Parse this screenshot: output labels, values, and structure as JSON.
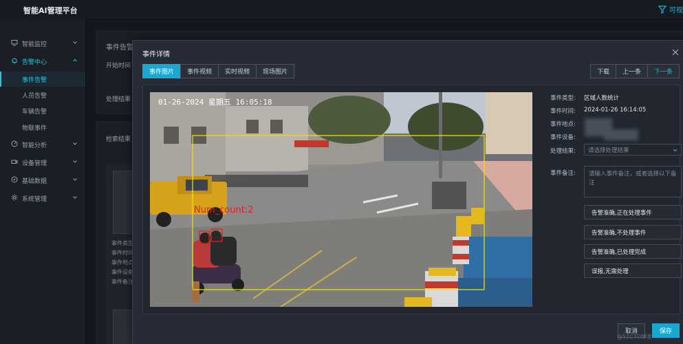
{
  "app": {
    "title": "智能AI管理平台",
    "filter_label": "可视"
  },
  "sidebar": {
    "items": [
      {
        "label": "智能监控",
        "icon": "monitor-icon"
      },
      {
        "label": "告警中心",
        "icon": "bell-icon"
      },
      {
        "label": "智能分析",
        "icon": "analysis-icon"
      },
      {
        "label": "设备管理",
        "icon": "camera-icon"
      },
      {
        "label": "基础数据",
        "icon": "compass-icon"
      },
      {
        "label": "系统管理",
        "icon": "gear-icon"
      }
    ],
    "sub_items": [
      {
        "label": "事件告警"
      },
      {
        "label": "人员告警"
      },
      {
        "label": "车辆告警"
      },
      {
        "label": "物联事件"
      }
    ]
  },
  "background": {
    "card_title": "事件告警",
    "start_time_label": "开始时间",
    "result_label": "处理结果",
    "search_results_label": "检索结果",
    "card_labels": [
      "事件类型",
      "事件时间",
      "事件地点",
      "事件设备",
      "事件备注"
    ]
  },
  "modal": {
    "title": "事件详情",
    "tabs": [
      "事件图片",
      "事件视频",
      "实时视频",
      "现场图片"
    ],
    "nav": [
      "下载",
      "上一条",
      "下一条"
    ],
    "camera": {
      "timestamp": "01-26-2024 星期五 16:05:18",
      "count_label": "Num_count:2"
    },
    "details": {
      "type_label": "事件类型:",
      "type_value": "区域人数统计",
      "time_label": "事件时间:",
      "time_value": "2024-01-26 16:14:05",
      "location_label": "事件地点:",
      "device_label": "事件设备:",
      "result_label": "处理结果:",
      "result_placeholder": "请选择处理结果",
      "remark_label": "事件备注:",
      "remark_placeholder": "请输入事件备注，或者选择以下备注"
    },
    "quick_remarks": [
      "告警准确,正在处理事件",
      "告警准确,不处理事件",
      "告警准确,已处理完成",
      "误报,无需处理"
    ],
    "cancel_label": "取消",
    "save_label": "保存",
    "watermark": "@51CTO博客"
  },
  "colors": {
    "accent": "#1aa8d2",
    "detection_box": "#e8e000",
    "person_box": "#e02020"
  }
}
